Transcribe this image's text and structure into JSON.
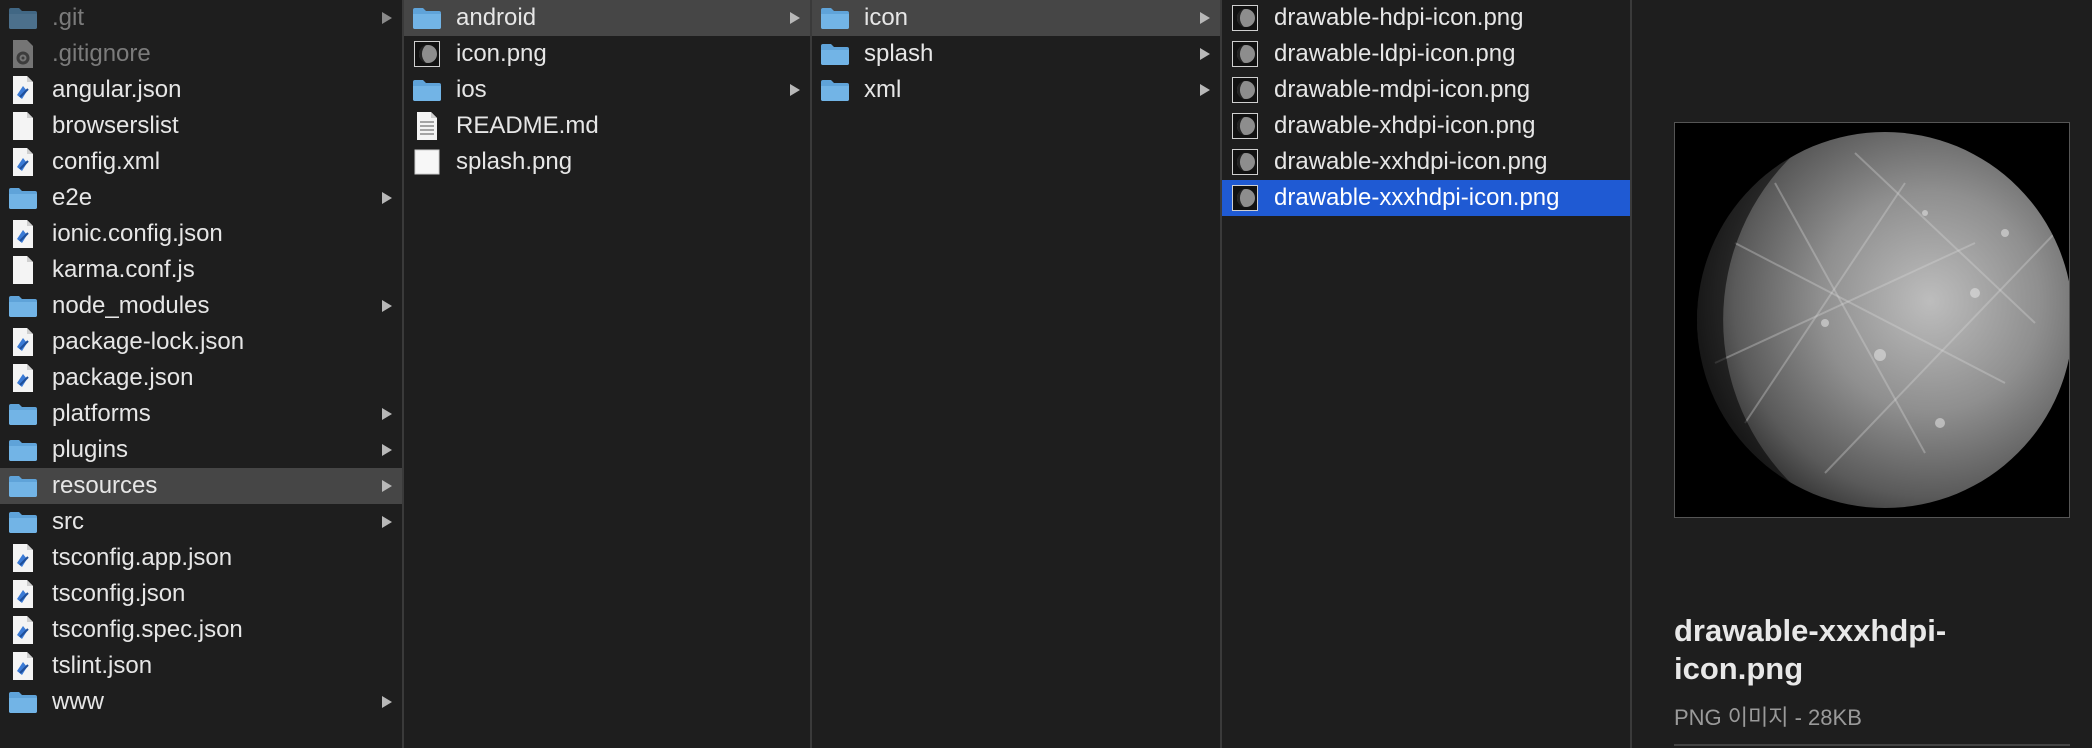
{
  "columns": [
    {
      "items": [
        {
          "label": ".git",
          "icon": "folder-icon",
          "dim": true,
          "arrow": true
        },
        {
          "label": ".gitignore",
          "icon": "gear-file-icon",
          "dim": true,
          "arrow": false
        },
        {
          "label": "angular.json",
          "icon": "code-file-icon",
          "arrow": false
        },
        {
          "label": "browserslist",
          "icon": "document-icon",
          "arrow": false
        },
        {
          "label": "config.xml",
          "icon": "code-file-icon",
          "arrow": false
        },
        {
          "label": "e2e",
          "icon": "folder-icon",
          "arrow": true
        },
        {
          "label": "ionic.config.json",
          "icon": "code-file-icon",
          "arrow": false
        },
        {
          "label": "karma.conf.js",
          "icon": "document-icon",
          "arrow": false
        },
        {
          "label": "node_modules",
          "icon": "folder-icon",
          "arrow": true
        },
        {
          "label": "package-lock.json",
          "icon": "code-file-icon",
          "arrow": false
        },
        {
          "label": "package.json",
          "icon": "code-file-icon",
          "arrow": false
        },
        {
          "label": "platforms",
          "icon": "folder-icon",
          "arrow": true
        },
        {
          "label": "plugins",
          "icon": "folder-icon",
          "arrow": true
        },
        {
          "label": "resources",
          "icon": "folder-icon",
          "arrow": true,
          "selected": "gray"
        },
        {
          "label": "src",
          "icon": "folder-icon",
          "arrow": true
        },
        {
          "label": "tsconfig.app.json",
          "icon": "code-file-icon",
          "arrow": false
        },
        {
          "label": "tsconfig.json",
          "icon": "code-file-icon",
          "arrow": false
        },
        {
          "label": "tsconfig.spec.json",
          "icon": "code-file-icon",
          "arrow": false
        },
        {
          "label": "tslint.json",
          "icon": "code-file-icon",
          "arrow": false
        },
        {
          "label": "www",
          "icon": "folder-icon",
          "arrow": true
        }
      ]
    },
    {
      "items": [
        {
          "label": "android",
          "icon": "folder-icon",
          "arrow": true,
          "selected": "gray"
        },
        {
          "label": "icon.png",
          "icon": "image-thumb-icon",
          "arrow": false
        },
        {
          "label": "ios",
          "icon": "folder-icon",
          "arrow": true
        },
        {
          "label": "README.md",
          "icon": "text-file-icon",
          "arrow": false
        },
        {
          "label": "splash.png",
          "icon": "blank-image-icon",
          "arrow": false
        }
      ]
    },
    {
      "items": [
        {
          "label": "icon",
          "icon": "folder-icon",
          "arrow": true,
          "selected": "gray"
        },
        {
          "label": "splash",
          "icon": "folder-icon",
          "arrow": true
        },
        {
          "label": "xml",
          "icon": "folder-icon",
          "arrow": true
        }
      ]
    },
    {
      "items": [
        {
          "label": "drawable-hdpi-icon.png",
          "icon": "image-thumb-icon",
          "arrow": false
        },
        {
          "label": "drawable-ldpi-icon.png",
          "icon": "image-thumb-icon",
          "arrow": false
        },
        {
          "label": "drawable-mdpi-icon.png",
          "icon": "image-thumb-icon",
          "arrow": false
        },
        {
          "label": "drawable-xhdpi-icon.png",
          "icon": "image-thumb-icon",
          "arrow": false
        },
        {
          "label": "drawable-xxhdpi-icon.png",
          "icon": "image-thumb-icon",
          "arrow": false
        },
        {
          "label": "drawable-xxxhdpi-icon.png",
          "icon": "image-thumb-icon",
          "arrow": false,
          "selected": "blue"
        }
      ]
    }
  ],
  "preview": {
    "title": "drawable-xxxhdpi-icon.png",
    "subtitle": "PNG 이미지 - 28KB",
    "image": "planet-image"
  },
  "colors": {
    "background": "#1e1e1e",
    "selection_active": "#1f5ad3",
    "selection_inactive": "#464646",
    "folder": "#5fa3d9"
  }
}
